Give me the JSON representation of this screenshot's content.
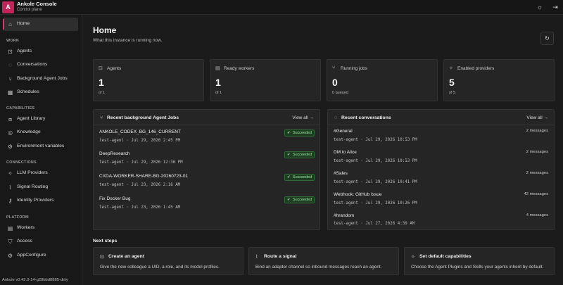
{
  "header": {
    "logo_letter": "A",
    "app_title": "Ankole Console",
    "app_subtitle": "Control plane",
    "theme_icon": "☼",
    "logout_icon": "⇥"
  },
  "sidebar": {
    "home": "Home",
    "sections": {
      "work": "WORK",
      "capabilities": "CAPABILITIES",
      "connections": "CONNECTIONS",
      "platform": "PLATFORM"
    },
    "items": {
      "agents": "Agents",
      "conversations": "Conversations",
      "background_jobs": "Background Agent Jobs",
      "schedules": "Schedules",
      "agent_library": "Agent Library",
      "knowledge": "Knowledge",
      "env_vars": "Environment variables",
      "llm_providers": "LLM Providers",
      "signal_routing": "Signal Routing",
      "identity_providers": "Identity Providers",
      "workers": "Workers",
      "access": "Access",
      "app_configure": "AppConfigure"
    },
    "version": "Ankole v0.42.0-14-g28bbd8885-dirty"
  },
  "main": {
    "title": "Home",
    "subtitle": "What this instance is running now.",
    "refresh_icon": "↻"
  },
  "stats": [
    {
      "label": "Agents",
      "value": "1",
      "sub": "of 1"
    },
    {
      "label": "Ready workers",
      "value": "1",
      "sub": "of 1"
    },
    {
      "label": "Running jobs",
      "value": "0",
      "sub": "0 queued"
    },
    {
      "label": "Enabled providers",
      "value": "5",
      "sub": "of 5"
    }
  ],
  "jobs": {
    "title": "Recent background Agent Jobs",
    "view_all": "View all →",
    "items": [
      {
        "name": "ANKOLE_CODEX_BG_146_CURRENT",
        "meta": "test-agent · Jul 29, 2026 2:45 PM",
        "status": "Succeeded"
      },
      {
        "name": "DeepResearch",
        "meta": "test-agent · Jul 29, 2026 12:36 PM",
        "status": "Succeeded"
      },
      {
        "name": "CXDA-WORKER-SHARE-BG-20260723-01",
        "meta": "test-agent · Jul 23, 2026 2:16 AM",
        "status": "Succeeded"
      },
      {
        "name": "Fix Docker Bug",
        "meta": "test-agent · Jul 23, 2026 1:45 AM",
        "status": "Succeeded"
      }
    ]
  },
  "conversations": {
    "title": "Recent conversations",
    "view_all": "View all →",
    "items": [
      {
        "name": "#General",
        "meta": "test-agent · Jul 29, 2026 10:53 PM",
        "count": "2 messages"
      },
      {
        "name": "DM to Alice",
        "meta": "test-agent · Jul 29, 2026 10:53 PM",
        "count": "2 messages"
      },
      {
        "name": "#Sales",
        "meta": "test-agent · Jul 29, 2026 10:41 PM",
        "count": "2 messages"
      },
      {
        "name": "Webhook: GitHub Issue",
        "meta": "test-agent · Jul 29, 2026 10:26 PM",
        "count": "42 messages"
      },
      {
        "name": "#hrandom",
        "meta": "test-agent · Jul 27, 2026 4:30 AM",
        "count": "4 messages"
      }
    ]
  },
  "next_steps": {
    "title": "Next steps",
    "items": [
      {
        "title": "Create an agent",
        "desc": "Give the new colleague a UID, a role, and its model profiles."
      },
      {
        "title": "Route a signal",
        "desc": "Bind an adapter channel so inbound messages reach an agent."
      },
      {
        "title": "Set default capabilities",
        "desc": "Choose the Agent Plugins and Skills your agents inherit by default."
      }
    ]
  },
  "colors": {
    "accent": "#c0245a",
    "success_bg": "#1e3d22",
    "success_text": "#9ee3a6"
  }
}
